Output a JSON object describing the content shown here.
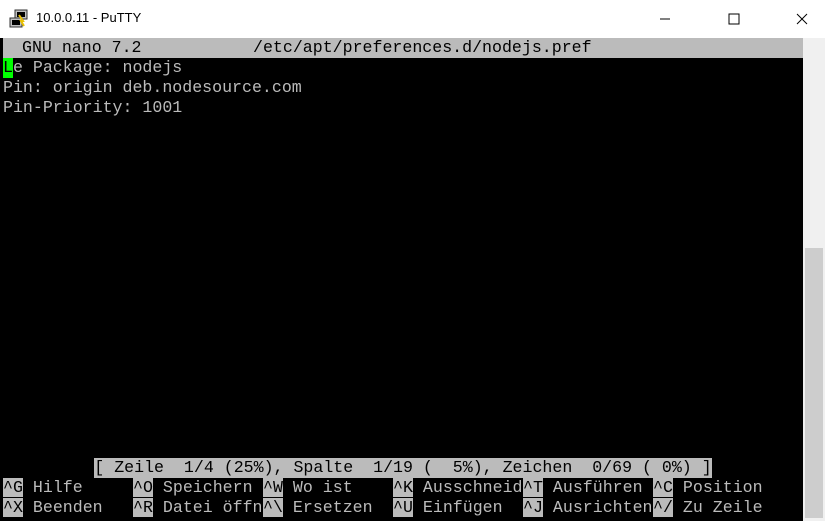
{
  "window": {
    "title": "10.0.0.11 - PuTTY",
    "icon": "putty-app-icon",
    "controls": [
      "minimize-icon",
      "maximize-icon",
      "close-icon"
    ]
  },
  "nano": {
    "header": {
      "program": "GNU nano 7.2",
      "file": "/etc/apt/preferences.d/nodejs.pref"
    },
    "lines": [
      {
        "cursor_char": "L",
        "rest": "e Package: nodejs"
      },
      {
        "text": "Pin: origin deb.nodesource.com"
      },
      {
        "text": "Pin-Priority: 1001"
      }
    ],
    "status": "[ Zeile  1/4 (25%), Spalte  1/19 (  5%), Zeichen  0/69 ( 0%) ]",
    "shortcuts_row1": [
      {
        "key": "^G",
        "label": "Hilfe"
      },
      {
        "key": "^O",
        "label": "Speichern"
      },
      {
        "key": "^W",
        "label": "Wo ist"
      },
      {
        "key": "^K",
        "label": "Ausschneid"
      },
      {
        "key": "^T",
        "label": "Ausführen"
      },
      {
        "key": "^C",
        "label": "Position"
      }
    ],
    "shortcuts_row2": [
      {
        "key": "^X",
        "label": "Beenden"
      },
      {
        "key": "^R",
        "label": "Datei öffn"
      },
      {
        "key": "^\\",
        "label": "Ersetzen"
      },
      {
        "key": "^U",
        "label": "Einfügen"
      },
      {
        "key": "^J",
        "label": "Ausrichten"
      },
      {
        "key": "^/",
        "label": "Zu Zeile"
      }
    ]
  },
  "colors": {
    "terminal_bg": "#000000",
    "terminal_fg": "#bbbbbb",
    "cursor": "#00ff00",
    "scrollbar_track": "#f0f0f0",
    "scrollbar_thumb": "#cdcdcd"
  }
}
